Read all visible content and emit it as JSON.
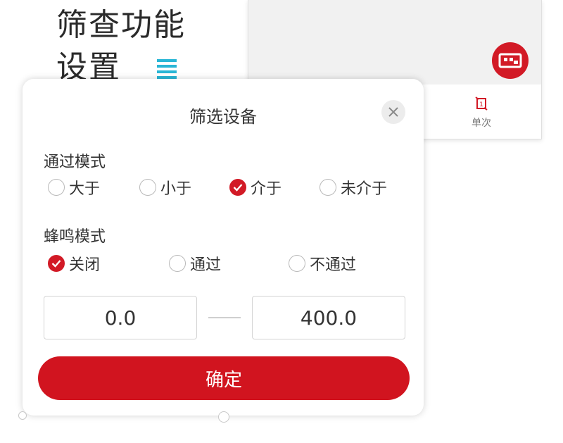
{
  "annotation": {
    "line1": "筛查功能",
    "line2": "设置"
  },
  "background_app": {
    "tab_single_label": "单次"
  },
  "dialog": {
    "title": "筛选设备",
    "pass_mode": {
      "label": "通过模式",
      "options": [
        {
          "label": "大于",
          "checked": false
        },
        {
          "label": "小于",
          "checked": false
        },
        {
          "label": "介于",
          "checked": true
        },
        {
          "label": "未介于",
          "checked": false
        }
      ]
    },
    "buzzer_mode": {
      "label": "蜂鸣模式",
      "options": [
        {
          "label": "关闭",
          "checked": true
        },
        {
          "label": "通过",
          "checked": false
        },
        {
          "label": "不通过",
          "checked": false
        }
      ]
    },
    "range": {
      "min_value": "0.0",
      "max_value": "400.0"
    },
    "confirm_label": "确定"
  },
  "colors": {
    "accent": "#d21a26",
    "pointer": "#29b6d6"
  },
  "icons": [
    "close-icon",
    "check-icon",
    "brand-logo-icon",
    "single-mode-icon",
    "pointer-arrow-icon"
  ]
}
